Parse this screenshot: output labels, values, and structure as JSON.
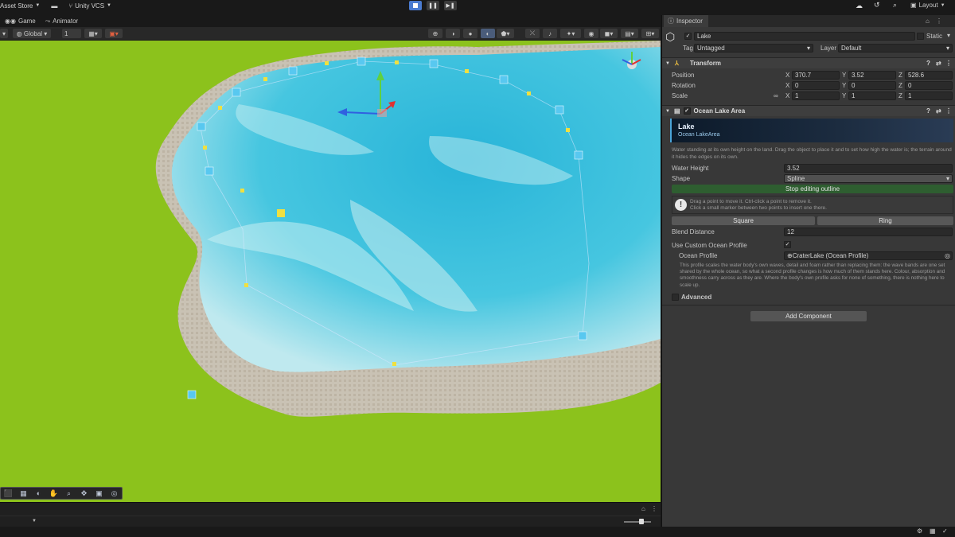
{
  "topbar": {
    "asset_store": "Asset Store",
    "unity_vcs": "Unity VCS",
    "layout": "Layout"
  },
  "tabs": {
    "game": "Game",
    "animator": "Animator"
  },
  "scene_toolbar": {
    "pivot_space": "Global",
    "snap_value": "1"
  },
  "inspector": {
    "tab_title": "Inspector",
    "object_name": "Lake",
    "static_label": "Static",
    "tag_label": "Tag",
    "tag_value": "Untagged",
    "layer_label": "Layer",
    "layer_value": "Default",
    "transform": {
      "title": "Transform",
      "position_label": "Position",
      "rotation_label": "Rotation",
      "scale_label": "Scale",
      "position": {
        "x": "370.7",
        "y": "3.52",
        "z": "528.6"
      },
      "rotation": {
        "x": "0",
        "y": "0",
        "z": "0"
      },
      "scale": {
        "x": "1",
        "y": "1",
        "z": "1"
      },
      "axis": {
        "x": "X",
        "y": "Y",
        "z": "Z"
      }
    },
    "lake_area": {
      "title": "Ocean Lake Area",
      "banner_title": "Lake",
      "banner_subtitle": "Ocean LakeArea",
      "description": "Water standing at its own height on the land. Drag the object to place it and to set how high the water is; the terrain around it hides the edges on its own.",
      "water_height_label": "Water Height",
      "water_height_value": "3.52",
      "shape_label": "Shape",
      "shape_value": "Spline",
      "stop_editing_label": "Stop editing outline",
      "help_line1": "Drag a point to move it. Ctrl-click a point to remove it.",
      "help_line2": "Click a small marker between two points to insert one there.",
      "square_label": "Square",
      "ring_label": "Ring",
      "blend_distance_label": "Blend Distance",
      "blend_distance_value": "12",
      "use_custom_profile_label": "Use Custom Ocean Profile",
      "ocean_profile_label": "Ocean Profile",
      "ocean_profile_value": "CraterLake (Ocean Profile)",
      "profile_note": "This profile scales the water body's own waves, detail and foam rather than replacing them: the wave bands are one set shared by the whole ocean, so what a second profile changes is how much of them stands here. Colour, absorption and smoothness carry across as they are. Where the body's own profile asks for none of something, there is nothing here to scale up.",
      "advanced_label": "Advanced"
    },
    "add_component_label": "Add Component"
  },
  "colors": {
    "accent": "#4a7bd0",
    "grass": "#8cc21c",
    "water": "#2fbad6",
    "stop_button": "#2e5e30"
  }
}
